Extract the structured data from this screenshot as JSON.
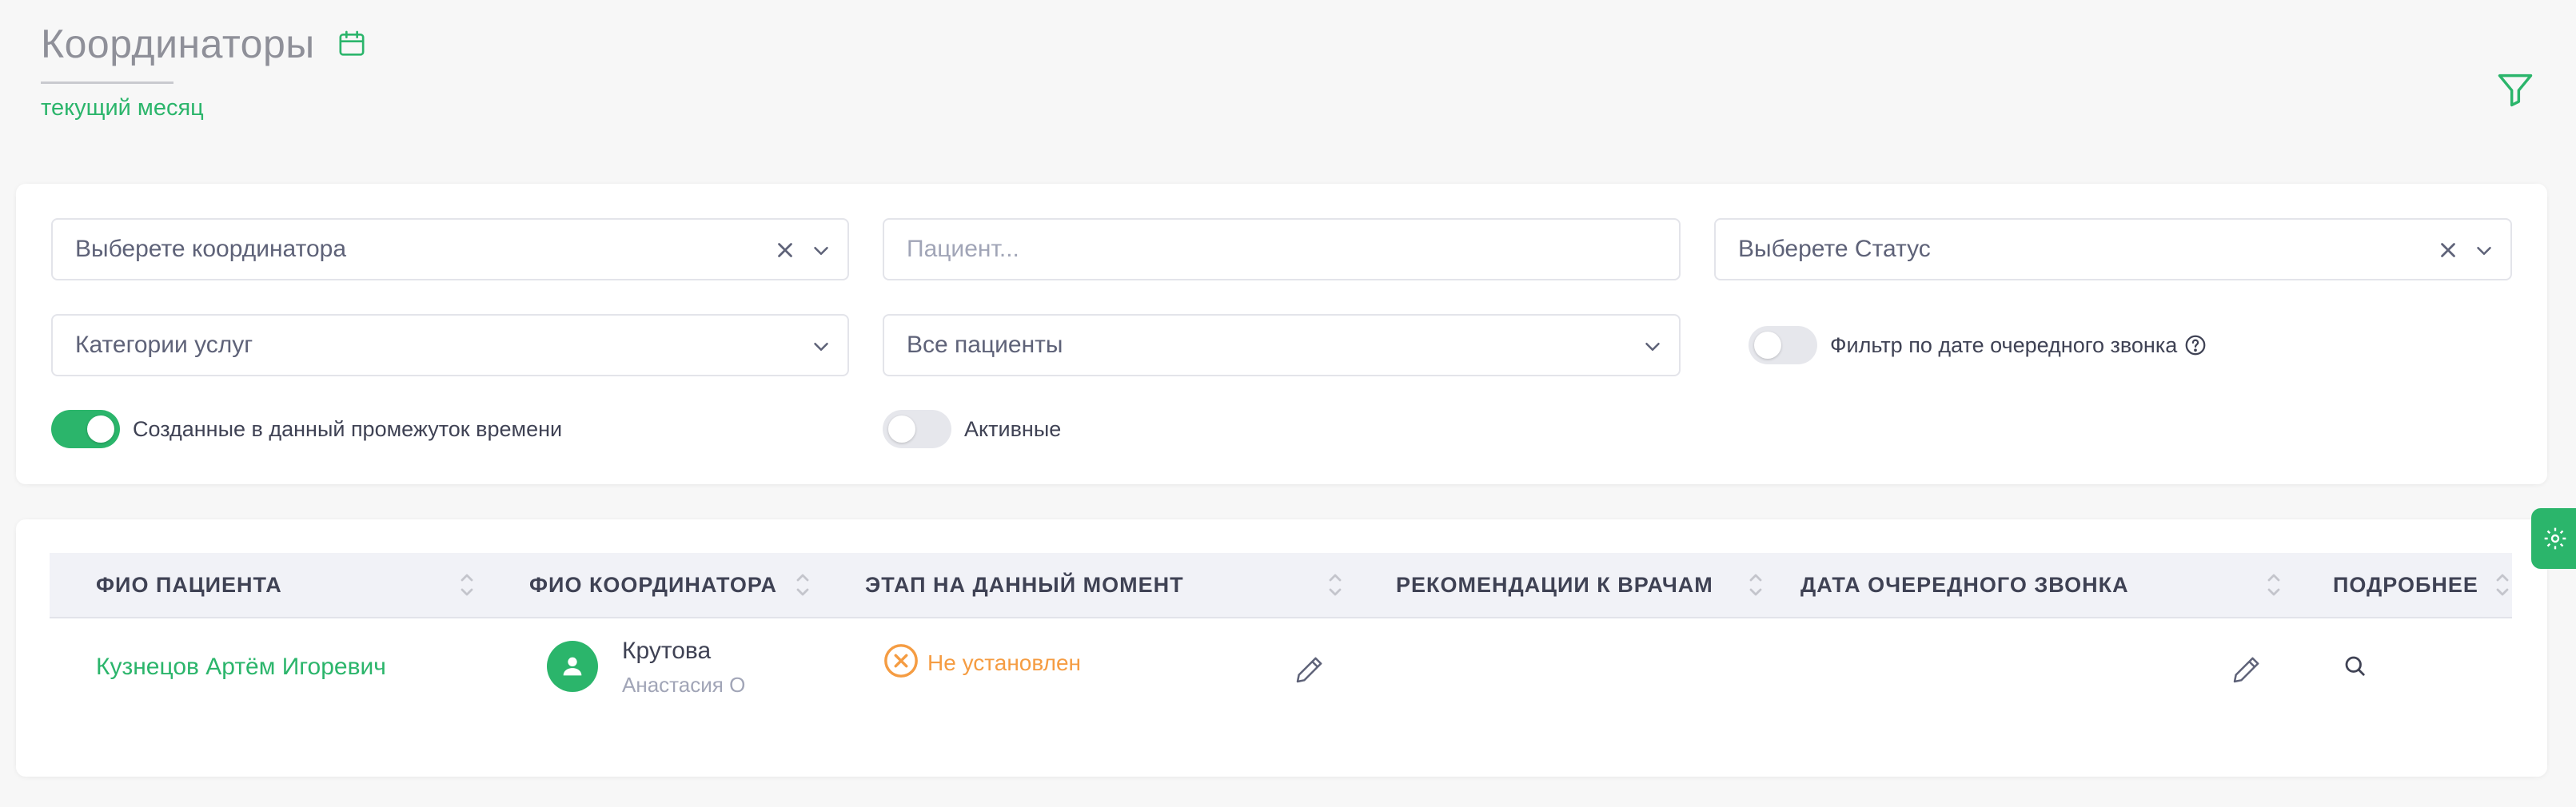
{
  "header": {
    "title": "Координаторы",
    "period": "текущий месяц"
  },
  "filters": {
    "coordinator": {
      "placeholder": "Выберете координатора"
    },
    "patient": {
      "placeholder": "Пациент..."
    },
    "status": {
      "placeholder": "Выберете Статус"
    },
    "service_categories": {
      "placeholder": "Категории услуг"
    },
    "patients_scope": {
      "value": "Все пациенты"
    },
    "next_call_date_filter": {
      "label": "Фильтр по дате очередного звонка",
      "enabled": false
    },
    "created_in_period": {
      "label": "Созданные в данный промежуток времени",
      "enabled": true
    },
    "active_only": {
      "label": "Активные",
      "enabled": false
    }
  },
  "table": {
    "columns": [
      "ФИО ПАЦИЕНТА",
      "ФИО КООРДИНАТОРА",
      "ЭТАП НА ДАННЫЙ МОМЕНТ",
      "РЕКОМЕНДАЦИИ К ВРАЧАМ",
      "ДАТА ОЧЕРЕДНОГО ЗВОНКА",
      "ПОДРОБНЕЕ"
    ],
    "rows": [
      {
        "patient": "Кузнецов Артём Игоревич",
        "coordinator_last": "Крутова",
        "coordinator_first": "Анастасия О",
        "stage": "Не установлен",
        "recommendations": "",
        "next_call": ""
      }
    ]
  },
  "colors": {
    "accent": "#2bb56b",
    "warning": "#f59c42",
    "muted": "#a1a5b7"
  },
  "icons": [
    "calendar-icon",
    "filter-icon",
    "close-icon",
    "chevron-down-icon",
    "help-icon",
    "sort-icon",
    "user-icon",
    "x-circle-icon",
    "pencil-icon",
    "search-icon",
    "gear-icon"
  ]
}
